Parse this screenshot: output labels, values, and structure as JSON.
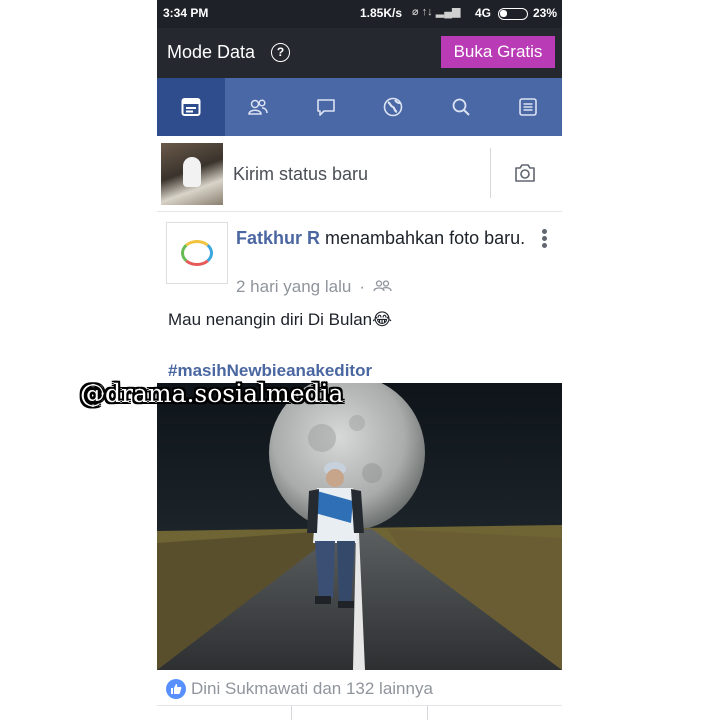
{
  "status_bar": {
    "time": "3:34 PM",
    "speed": "1.85K/s",
    "network": "4G",
    "battery": "23%"
  },
  "mode_bar": {
    "title": "Mode Data",
    "help_label": "?",
    "cta_label": "Buka Gratis",
    "cta_color": "#b93bb5"
  },
  "nav": {
    "tabs": [
      {
        "icon": "news-feed-icon",
        "active": true
      },
      {
        "icon": "friends-icon",
        "active": false
      },
      {
        "icon": "messages-icon",
        "active": false
      },
      {
        "icon": "globe-icon",
        "active": false
      },
      {
        "icon": "search-icon",
        "active": false
      },
      {
        "icon": "menu-icon",
        "active": false
      }
    ],
    "color": "#4a67a6",
    "active_color": "#2f4c8c"
  },
  "composer": {
    "prompt": "Kirim status baru",
    "camera_icon": "camera-icon"
  },
  "post": {
    "author": "Fatkhur R",
    "action": " menambahkan foto baru.",
    "time": "2 hari yang lalu",
    "separator": "·",
    "audience_icon": "friends-icon",
    "text": "Mau nenangin diri  Di Bulan😂",
    "hashtag": "#masihNewbieanakeditor",
    "reactions_text": "Dini Sukmawati dan 132 lainnya"
  },
  "watermark": "@drama.sosialmedia"
}
